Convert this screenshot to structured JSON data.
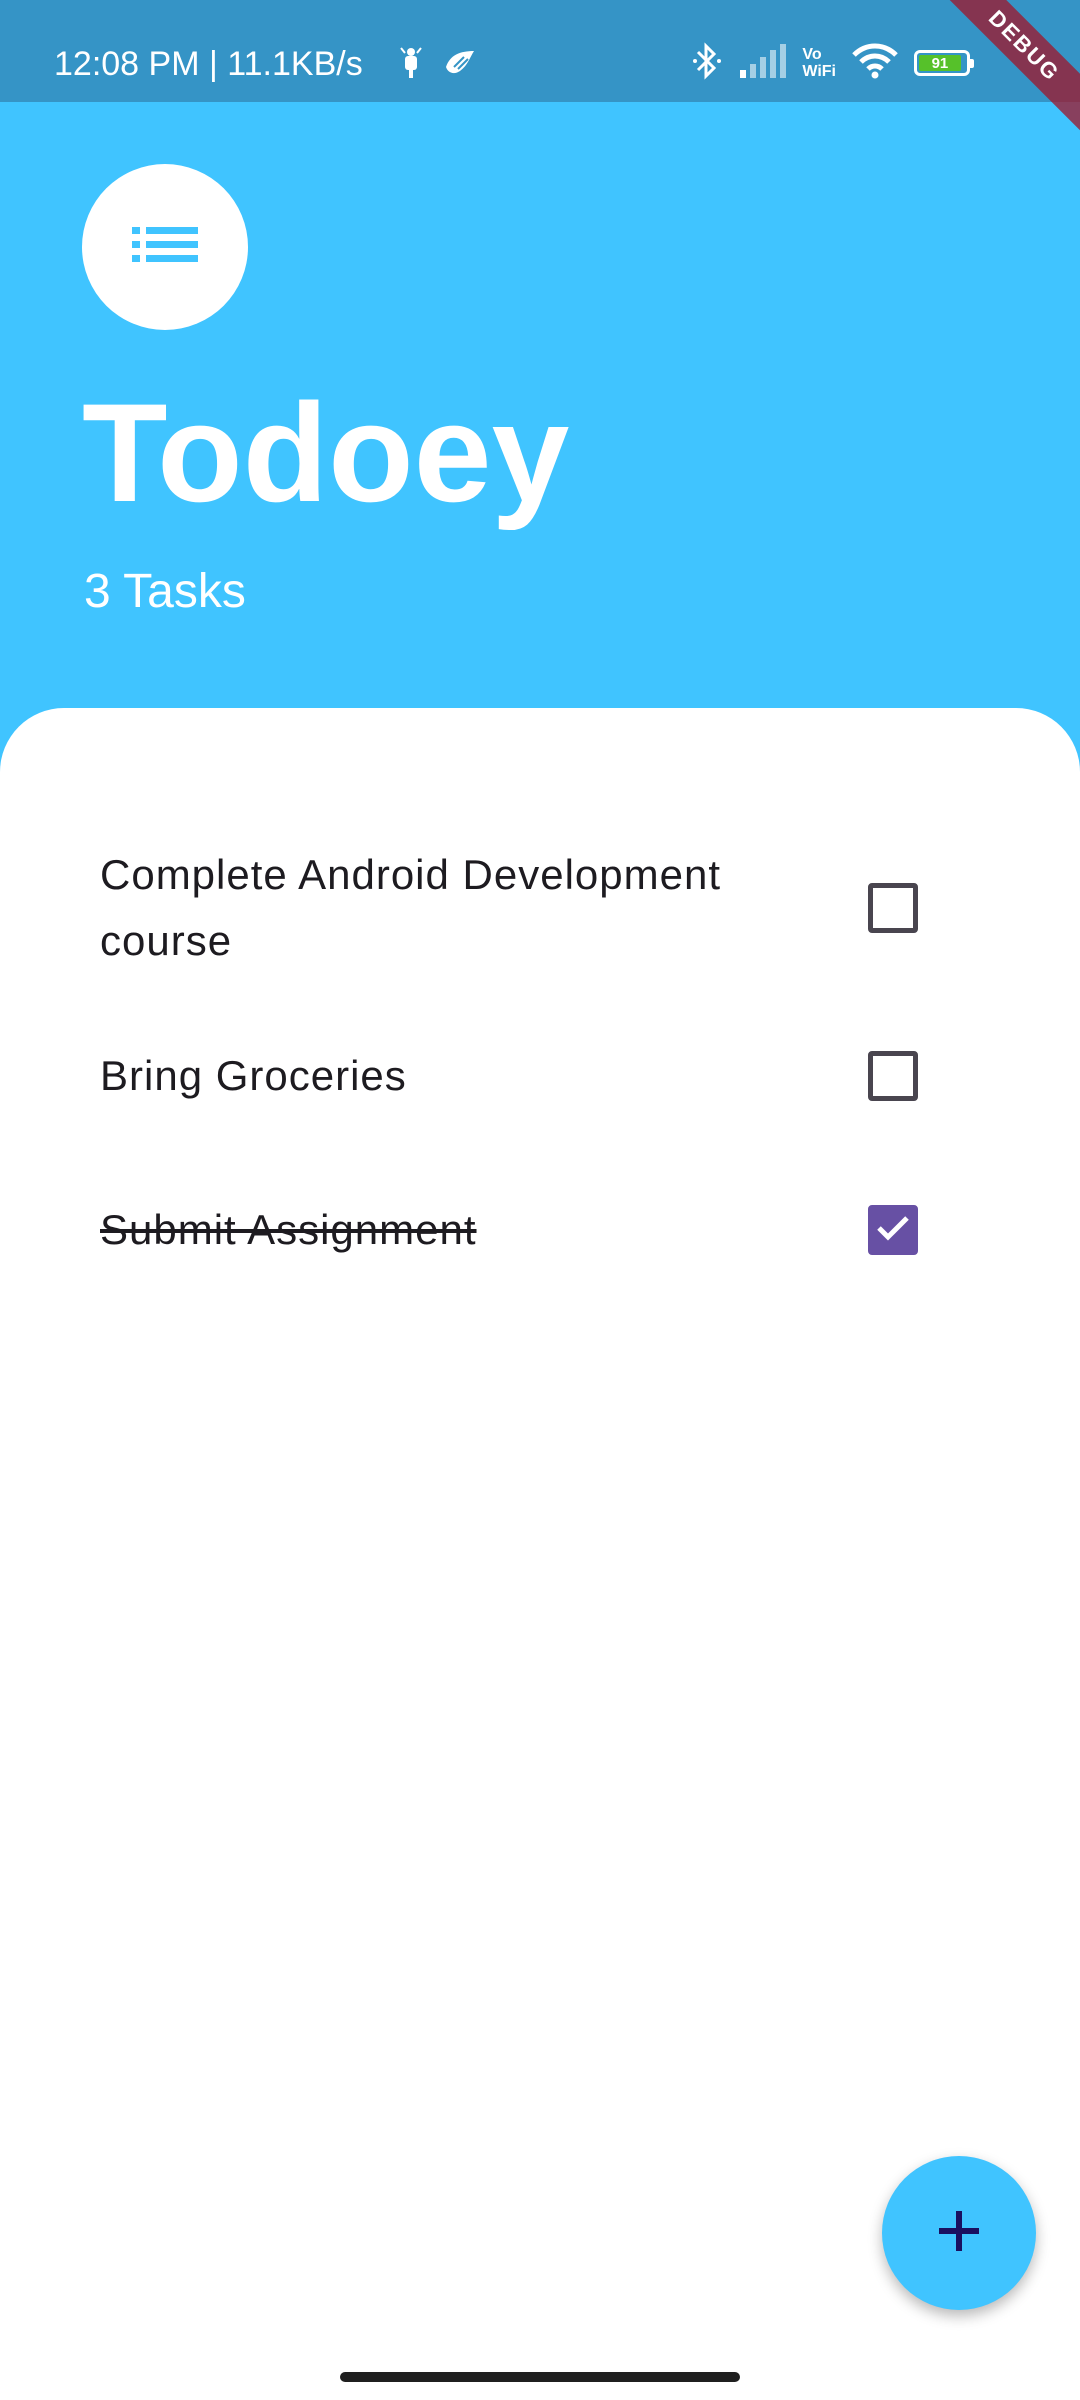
{
  "status_bar": {
    "time_speed": "12:08 PM | 11.1KB/s",
    "icons": [
      "notification-icon",
      "bird-app-icon",
      "bluetooth-icon",
      "signal-icon",
      "vowifi-icon",
      "wifi-icon",
      "battery-icon"
    ],
    "vowifi_top": "Vo",
    "vowifi_bottom": "WiFi",
    "battery_level": "91",
    "battery_fraction": 0.91,
    "debug_label": "DEBUG"
  },
  "header": {
    "menu_icon": "list-icon",
    "title": "Todoey",
    "task_count": "3 Tasks"
  },
  "tasks": [
    {
      "title": "Complete Android Development course",
      "checked": false
    },
    {
      "title": "Bring Groceries",
      "checked": false
    },
    {
      "title": "Submit Assignment",
      "checked": true
    }
  ],
  "fab": {
    "icon": "add-icon",
    "label": "+"
  },
  "colors": {
    "accent": "#40c4ff",
    "status_bar": "#3594c6",
    "checkbox_checked": "#6750a4",
    "battery": "#56c12a",
    "text": "#1d1b20",
    "fab_icon": "#1a1060"
  }
}
